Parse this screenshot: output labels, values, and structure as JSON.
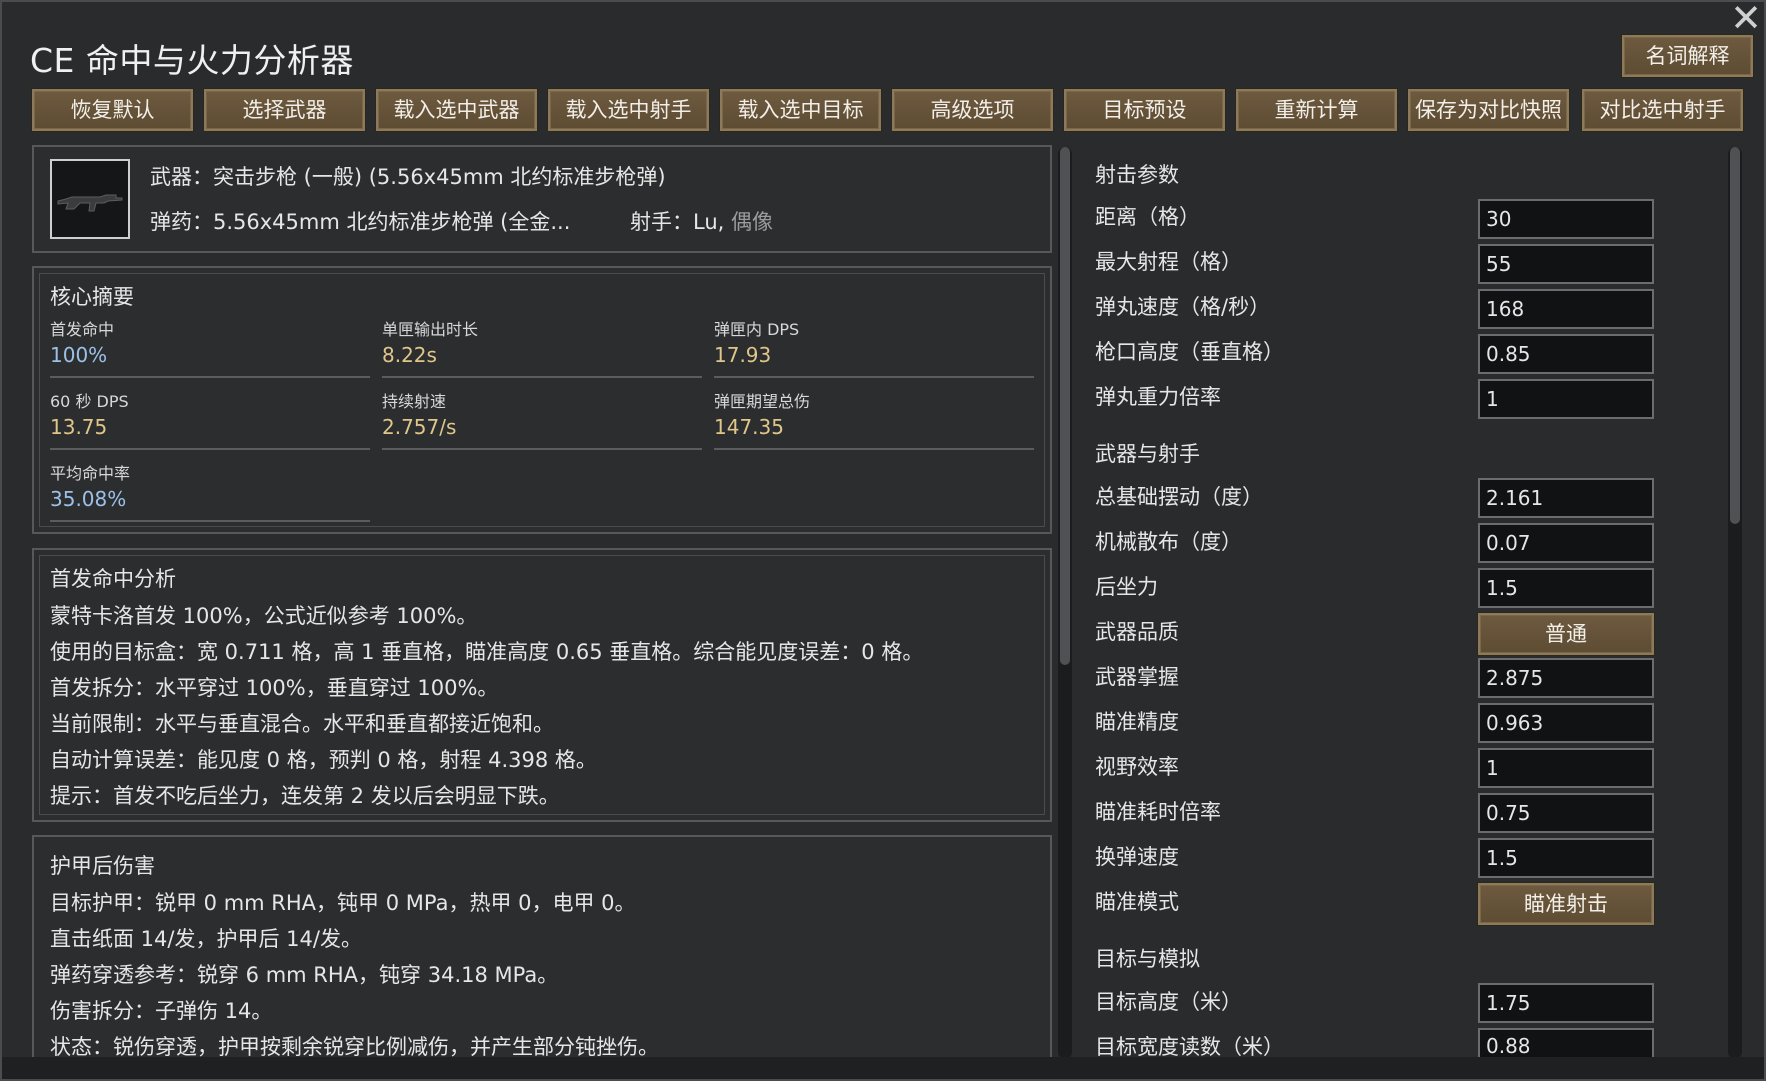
{
  "window": {
    "title": "CE 命中与火力分析器",
    "glossary_button": "名词解释"
  },
  "toolbar": [
    "恢复默认",
    "选择武器",
    "载入选中武器",
    "载入选中射手",
    "载入选中目标",
    "高级选项",
    "目标预设",
    "重新计算",
    "保存为对比快照",
    "对比选中射手"
  ],
  "weapon": {
    "icon": "rifle-icon",
    "weapon_line": "武器：突击步枪 (一般) (5.56x45mm 北约标准步枪弹)",
    "ammo_line": "弹药：5.56x45mm 北约标准步枪弹 (全金...",
    "shooter_label": "射手：Lu,",
    "shooter_trait": "偶像"
  },
  "summary": {
    "title": "核心摘要",
    "stats": [
      {
        "label": "首发命中",
        "value": "100%"
      },
      {
        "label": "单匣输出时长",
        "value": "8.22s"
      },
      {
        "label": "弹匣内 DPS",
        "value": "17.93"
      },
      {
        "label": "60 秒 DPS",
        "value": "13.75"
      },
      {
        "label": "持续射速",
        "value": "2.757/s"
      },
      {
        "label": "弹匣期望总伤",
        "value": "147.35"
      },
      {
        "label": "平均命中率",
        "value": "35.08%"
      }
    ]
  },
  "first_shot": {
    "title": "首发命中分析",
    "lines": [
      "蒙特卡洛首发 100%，公式近似参考 100%。",
      "使用的目标盒：宽 0.711 格，高 1 垂直格，瞄准高度 0.65 垂直格。综合能见度误差：0 格。",
      "首发拆分：水平穿过 100%，垂直穿过 100%。",
      "当前限制：水平与垂直混合。水平和垂直都接近饱和。",
      "自动计算误差：能见度 0 格，预判 0 格，射程 4.398 格。",
      "提示：首发不吃后坐力，连发第 2 发以后会明显下跌。"
    ]
  },
  "armor": {
    "title": "护甲后伤害",
    "lines": [
      "目标护甲：锐甲 0 mm RHA，钝甲 0 MPa，热甲 0，电甲 0。",
      "直击纸面 14/发，护甲后 14/发。",
      "弹药穿透参考：锐穿 6 mm RHA，钝穿 34.18 MPa。",
      "伤害拆分：子弹伤 14。",
      "状态：锐伤穿透，护甲按剩余锐穿比例减伤，并产生部分钝挫伤。"
    ]
  },
  "params": {
    "sec_shooting": "射击参数",
    "shooting": [
      {
        "label": "距离（格）",
        "value": "30"
      },
      {
        "label": "最大射程（格）",
        "value": "55"
      },
      {
        "label": "弹丸速度（格/秒）",
        "value": "168"
      },
      {
        "label": "枪口高度（垂直格）",
        "value": "0.85"
      },
      {
        "label": "弹丸重力倍率",
        "value": "1"
      }
    ],
    "sec_weapon": "武器与射手",
    "weapon_rows": [
      {
        "label": "总基础摆动（度）",
        "value": "2.161"
      },
      {
        "label": "机械散布（度）",
        "value": "0.07"
      },
      {
        "label": "后坐力",
        "value": "1.5"
      },
      {
        "label": "武器品质",
        "value": "普通"
      },
      {
        "label": "武器掌握",
        "value": "2.875"
      },
      {
        "label": "瞄准精度",
        "value": "0.963"
      },
      {
        "label": "视野效率",
        "value": "1"
      },
      {
        "label": "瞄准耗时倍率",
        "value": "0.75"
      },
      {
        "label": "换弹速度",
        "value": "1.5"
      },
      {
        "label": "瞄准模式",
        "value": "瞄准射击"
      }
    ],
    "sec_target": "目标与模拟",
    "target": [
      {
        "label": "目标高度（米）",
        "value": "1.75"
      },
      {
        "label": "目标宽度读数（米）",
        "value": "0.88"
      }
    ]
  }
}
